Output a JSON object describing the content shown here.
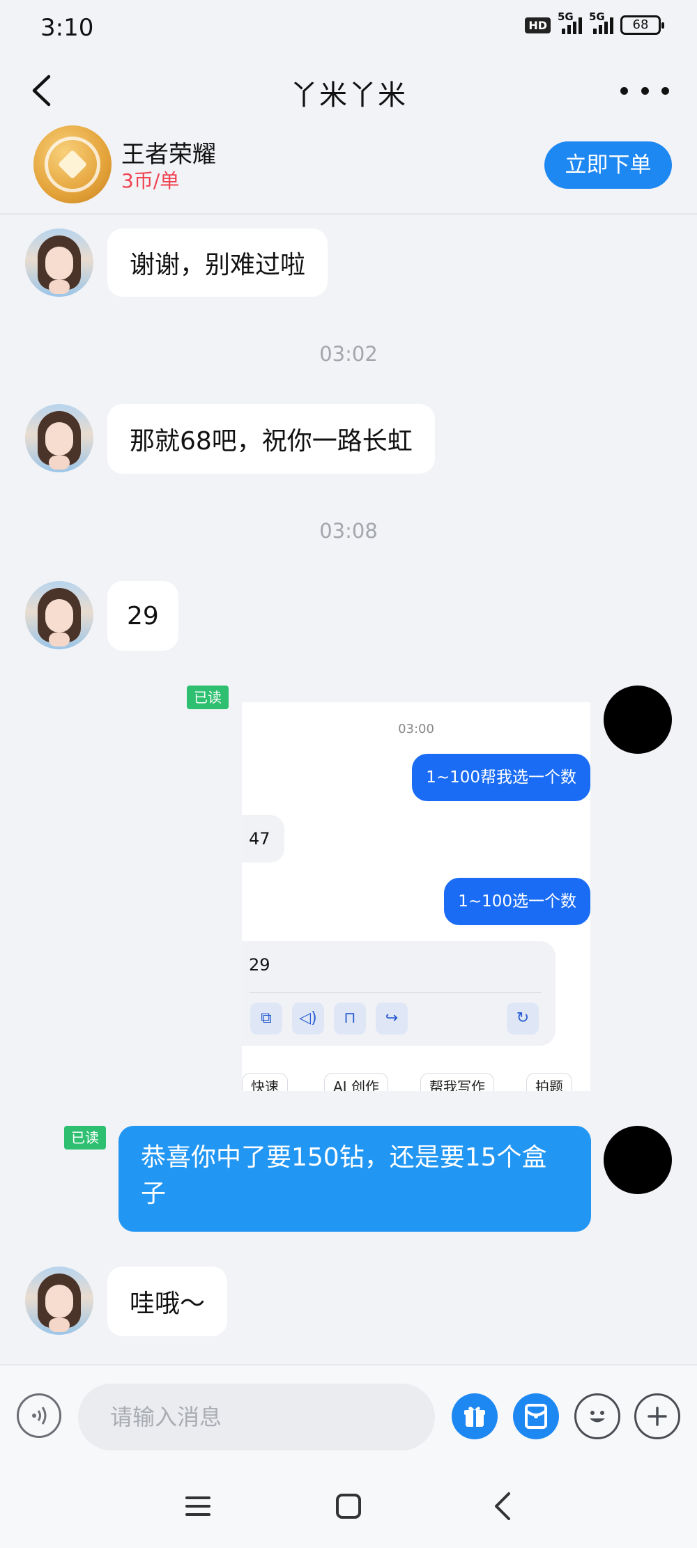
{
  "status_bar": {
    "time": "3:10",
    "hd_label": "HD",
    "network1": "5G",
    "network2": "5G",
    "battery": "68"
  },
  "header": {
    "title": "丫米丫米"
  },
  "service": {
    "name": "王者荣耀",
    "price": "3币/单",
    "order_label": "立即下单"
  },
  "messages": {
    "m1": "谢谢，别难过啦",
    "t1": "03:02",
    "m2": "那就68吧，祝你一路长虹",
    "t2": "03:08",
    "m3": "29",
    "read1": "已读",
    "read2": "已读",
    "m5": "恭喜你中了要150钻，还是要15个盒子",
    "m6": "哇哦～"
  },
  "screenshot": {
    "time": "03:00",
    "q1": "1~100帮我选一个数",
    "a1": "47",
    "q2": "1~100选一个数",
    "a2": "29",
    "chips": [
      "快速",
      "AI 创作",
      "帮我写作",
      "拍题"
    ]
  },
  "input": {
    "placeholder": "请输入消息"
  },
  "colors": {
    "accent": "#1e88f2",
    "price": "#f0424f",
    "read_badge": "#2fbf71",
    "background": "#f2f3f7"
  }
}
